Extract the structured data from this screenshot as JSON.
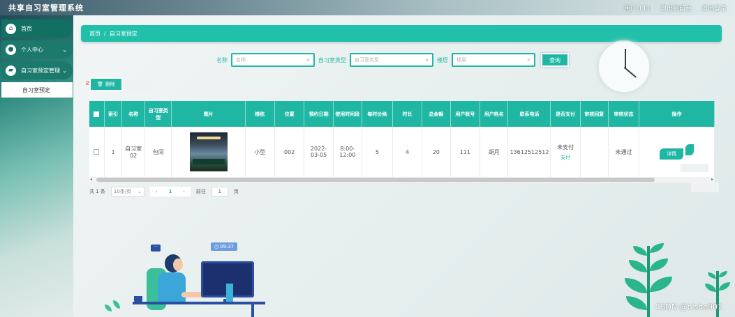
{
  "header": {
    "title": "共享自习室管理系统",
    "user": "用户:111",
    "exit_front": "退出到前台",
    "logout": "退出登录"
  },
  "sidebar": {
    "items": [
      {
        "label": "首页",
        "icon": "home-icon"
      },
      {
        "label": "个人中心",
        "icon": "user-icon",
        "arrow": "⌄"
      },
      {
        "label": "自习室预定管理",
        "icon": "folder-icon",
        "arrow": "⌄"
      }
    ],
    "sub_item": "自习室预定"
  },
  "breadcrumb": {
    "home": "首页",
    "sep": "/",
    "current": "自习室预定"
  },
  "search": {
    "fields": [
      {
        "label": "名称",
        "placeholder": "名称"
      },
      {
        "label": "自习室类型",
        "placeholder": "自习室类型"
      },
      {
        "label": "楼层",
        "placeholder": "楼层"
      }
    ],
    "query_label": "查询"
  },
  "toolbar": {
    "delete_label": "删除"
  },
  "table": {
    "headers": [
      "索引",
      "名称",
      "自习室类型",
      "图片",
      "楼栋",
      "位置",
      "预约日期",
      "使用时间段",
      "每时价格",
      "时长",
      "总金额",
      "用户账号",
      "用户姓名",
      "联系电话",
      "是否支付",
      "审核回复",
      "审核状态",
      "操作"
    ],
    "row": {
      "index": "1",
      "name": "自习室02",
      "type": "包间",
      "building": "小型",
      "position": "002",
      "date": "2022-03-05",
      "time_slot": "8:00-12:00",
      "price": "5",
      "duration": "4",
      "total": "20",
      "account": "111",
      "username": "胡月",
      "phone": "13612512512",
      "paid": "未支付",
      "pay_link": "支付",
      "reply": "",
      "status": "未通过",
      "op_label": "详情"
    }
  },
  "pager": {
    "total": "共 1 条",
    "page_size": "10条/页",
    "current_page": "1",
    "goto": "前往",
    "goto_value": "1",
    "page_unit": "页"
  },
  "illustration": {
    "time": "09:37"
  },
  "watermark": "CSDN @bishe901"
}
